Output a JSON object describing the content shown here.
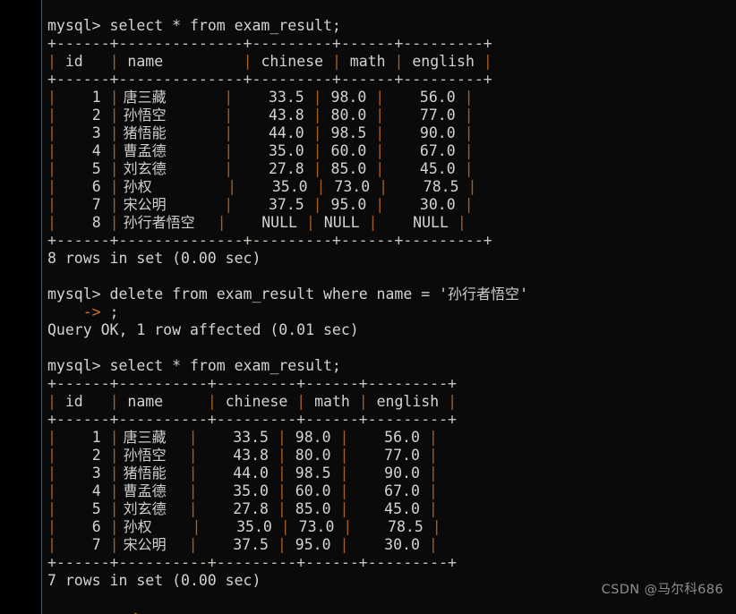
{
  "terminal": {
    "prompt": "mysql> ",
    "continuation": "    -> ",
    "background_color": "#0a0a0a",
    "text_color": "#d3d3d3",
    "pipe_color": "#a85e1e",
    "rule_color": "#c9c4bb",
    "continuation_color": "#c87a2a"
  },
  "watermark": {
    "text": "CSDN @马尔科686"
  },
  "columns": [
    "id",
    "name",
    "chinese",
    "math",
    "english"
  ],
  "blocks": [
    {
      "command": "select * from exam_result;",
      "status": "8 rows in set (0.00 sec)"
    },
    {
      "command": "delete from exam_result where name = '孙行者悟空'",
      "continuation": ";",
      "status": "Query OK, 1 row affected (0.01 sec)"
    },
    {
      "command": "select * from exam_result;",
      "status": "7 rows in set (0.00 sec)"
    }
  ],
  "bottom_cut_text": "    -> ",
  "table_one": {
    "widths": {
      "id": 6,
      "name": 14,
      "chinese": 9,
      "math": 6,
      "english": 9
    },
    "headers": [
      "id",
      "name",
      "chinese",
      "math",
      "english"
    ],
    "rows": [
      {
        "id": "1",
        "name": "唐三藏",
        "chinese": "33.5",
        "math": "98.0",
        "english": "56.0"
      },
      {
        "id": "2",
        "name": "孙悟空",
        "chinese": "43.8",
        "math": "80.0",
        "english": "77.0"
      },
      {
        "id": "3",
        "name": "猪悟能",
        "chinese": "44.0",
        "math": "98.5",
        "english": "90.0"
      },
      {
        "id": "4",
        "name": "曹孟德",
        "chinese": "35.0",
        "math": "60.0",
        "english": "67.0"
      },
      {
        "id": "5",
        "name": "刘玄德",
        "chinese": "27.8",
        "math": "85.0",
        "english": "45.0"
      },
      {
        "id": "6",
        "name": "孙权",
        "chinese": "35.0",
        "math": "73.0",
        "english": "78.5"
      },
      {
        "id": "7",
        "name": "宋公明",
        "chinese": "37.5",
        "math": "95.0",
        "english": "30.0"
      },
      {
        "id": "8",
        "name": "孙行者悟空",
        "chinese": "NULL",
        "math": "NULL",
        "english": "NULL"
      }
    ]
  },
  "table_two": {
    "widths": {
      "id": 6,
      "name": 10,
      "chinese": 9,
      "math": 6,
      "english": 9
    },
    "headers": [
      "id",
      "name",
      "chinese",
      "math",
      "english"
    ],
    "rows": [
      {
        "id": "1",
        "name": "唐三藏",
        "chinese": "33.5",
        "math": "98.0",
        "english": "56.0"
      },
      {
        "id": "2",
        "name": "孙悟空",
        "chinese": "43.8",
        "math": "80.0",
        "english": "77.0"
      },
      {
        "id": "3",
        "name": "猪悟能",
        "chinese": "44.0",
        "math": "98.5",
        "english": "90.0"
      },
      {
        "id": "4",
        "name": "曹孟德",
        "chinese": "35.0",
        "math": "60.0",
        "english": "67.0"
      },
      {
        "id": "5",
        "name": "刘玄德",
        "chinese": "27.8",
        "math": "85.0",
        "english": "45.0"
      },
      {
        "id": "6",
        "name": "孙权",
        "chinese": "35.0",
        "math": "73.0",
        "english": "78.5"
      },
      {
        "id": "7",
        "name": "宋公明",
        "chinese": "37.5",
        "math": "95.0",
        "english": "30.0"
      }
    ]
  }
}
